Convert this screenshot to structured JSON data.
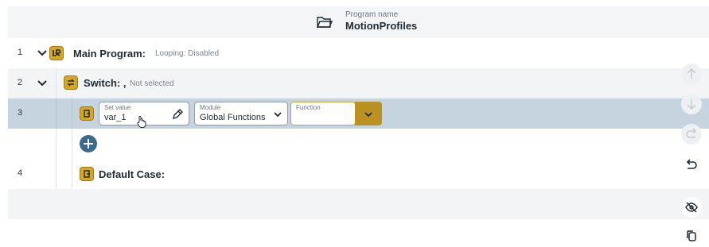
{
  "header": {
    "program_name_label": "Program name",
    "program_name": "MotionProfiles"
  },
  "rows": [
    {
      "num": "1",
      "title": "Main Program:",
      "sub": "Looping: Disabled"
    },
    {
      "num": "2",
      "title": "Switch: ,",
      "sub": "Not selected"
    },
    {
      "num": "3",
      "set_value": {
        "label": "Set value",
        "value": "var_1"
      },
      "module": {
        "label": "Module",
        "value": "Global Functions"
      },
      "function": {
        "label": "Function",
        "value": ""
      }
    },
    {
      "num": "4",
      "title": "Default Case:"
    }
  ],
  "colors": {
    "node": "#d6a723",
    "selected_row": "#c6d4e0",
    "add_button": "#3a6b8c"
  },
  "icons": [
    "folder-icon",
    "chevron-down-icon",
    "ur-logo-icon",
    "switch-icon",
    "node-icon",
    "pencil-icon",
    "plus-icon",
    "arrow-up-icon",
    "arrow-down-icon",
    "redo-icon",
    "undo-icon",
    "eye-off-icon",
    "copy-icon",
    "hand-cursor-icon"
  ]
}
